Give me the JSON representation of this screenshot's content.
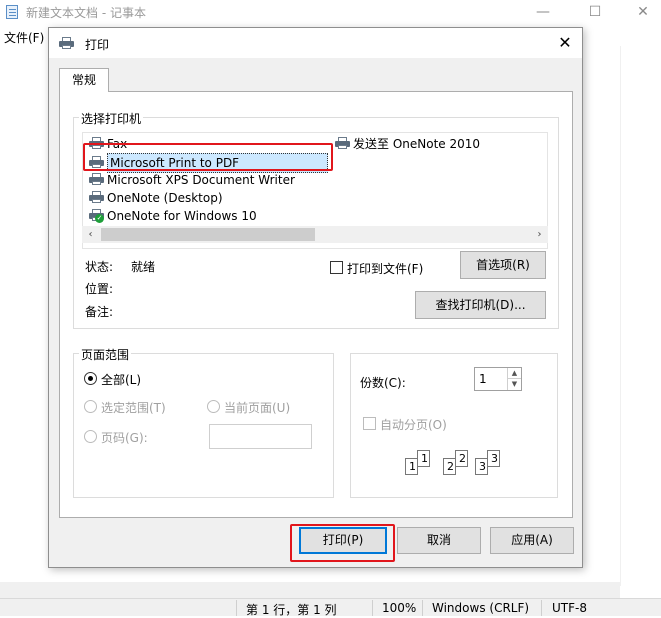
{
  "notepad": {
    "title": "新建文本文档 - 记事本",
    "menu_file": "文件(F)",
    "status": {
      "position": "第 1 行，第 1 列",
      "zoom": "100%",
      "line_ending": "Windows (CRLF)",
      "encoding": "UTF-8"
    }
  },
  "dialog": {
    "title": "打印",
    "close_glyph": "✕",
    "tab_general": "常规",
    "select_printer_label": "选择打印机",
    "printers": [
      {
        "name": "Fax"
      },
      {
        "name": "Microsoft Print to PDF",
        "selected": true
      },
      {
        "name": "Microsoft XPS Document Writer"
      },
      {
        "name": "OneNote (Desktop)"
      },
      {
        "name": "OneNote for Windows 10",
        "default": true
      },
      {
        "name": "发送至 OneNote 2010"
      }
    ],
    "status_label": "状态:",
    "status_value": "就绪",
    "location_label": "位置:",
    "comment_label": "备注:",
    "print_to_file_label": "打印到文件(F)",
    "preferences_button": "首选项(R)",
    "find_printer_button": "查找打印机(D)...",
    "page_range": {
      "label": "页面范围",
      "all": "全部(L)",
      "selection": "选定范围(T)",
      "current_page": "当前页面(U)",
      "pages": "页码(G):"
    },
    "copies_label": "份数(C):",
    "copies_value": "1",
    "collate_label": "自动分页(O)",
    "collate_pages": [
      "1",
      "1",
      "2",
      "2",
      "3",
      "3"
    ],
    "print_button": "打印(P)",
    "cancel_button": "取消",
    "apply_button": "应用(A)"
  },
  "colors": {
    "selection_bg": "#cce8ff",
    "highlight_box": "#e1161c",
    "default_button_border": "#0078d7"
  },
  "icons": {
    "printer": "printer-icon",
    "default_printer_badge": "check-badge-icon",
    "scroll_left": "‹",
    "scroll_right": "›",
    "spin_up": "▲",
    "spin_down": "▼"
  }
}
